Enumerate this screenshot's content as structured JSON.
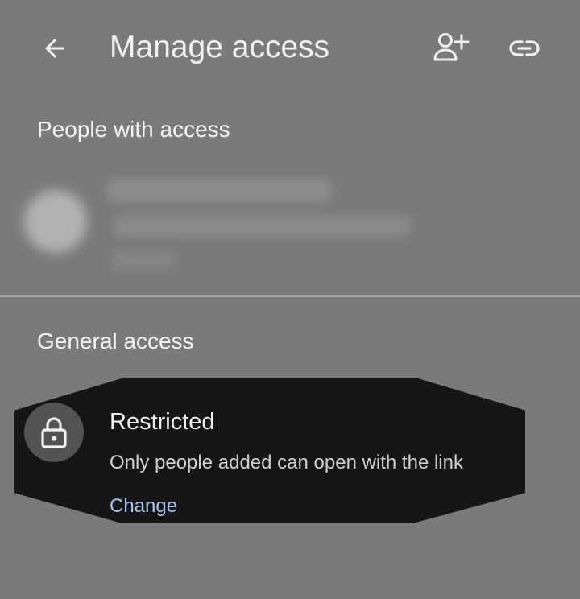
{
  "header": {
    "title": "Manage access",
    "icons": {
      "back": "arrow-back-icon",
      "add_person": "person-add-icon",
      "link": "link-icon"
    }
  },
  "people_section": {
    "heading": "People with access"
  },
  "general_section": {
    "heading": "General access",
    "access": {
      "icon": "lock-icon",
      "title": "Restricted",
      "description": "Only people added can open with the link",
      "change_label": "Change"
    }
  },
  "colors": {
    "background": "#7a7a7a",
    "card": "#161616",
    "link": "#a9c4f0",
    "text": "#f1f1f1"
  }
}
